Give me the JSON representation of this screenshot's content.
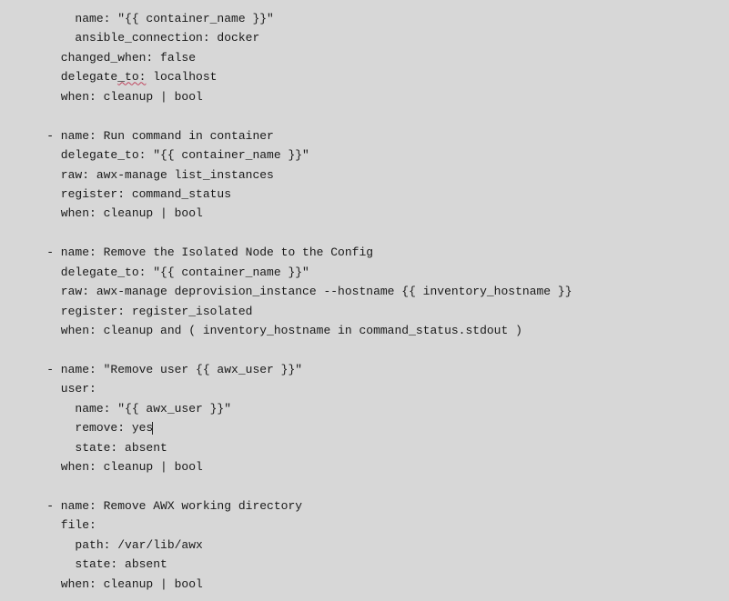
{
  "code": {
    "l1": "        name: \"{{ container_name }}\"",
    "l2": "        ansible_connection: docker",
    "l3": "      changed_when: false",
    "l4_pre": "      delegate",
    "l4_u": "_to:",
    "l4_post": " localhost",
    "l5": "      when: cleanup | bool",
    "blank1": "",
    "l6": "    - name: Run command in container",
    "l7": "      delegate_to: \"{{ container_name }}\"",
    "l8": "      raw: awx-manage list_instances",
    "l9": "      register: command_status",
    "l10": "      when: cleanup | bool",
    "blank2": "",
    "l11": "    - name: Remove the Isolated Node to the Config",
    "l12": "      delegate_to: \"{{ container_name }}\"",
    "l13": "      raw: awx-manage deprovision_instance --hostname {{ inventory_hostname }}",
    "l14": "      register: register_isolated",
    "l15": "      when: cleanup and ( inventory_hostname in command_status.stdout )",
    "blank3": "",
    "l16": "    - name: \"Remove user {{ awx_user }}\"",
    "l17": "      user:",
    "l18": "        name: \"{{ awx_user }}\"",
    "l19": "        remove: yes",
    "l20": "        state: absent",
    "l21": "      when: cleanup | bool",
    "blank4": "",
    "l22": "    - name: Remove AWX working directory",
    "l23": "      file:",
    "l24": "        path: /var/lib/awx",
    "l25": "        state: absent",
    "l26": "      when: cleanup | bool"
  }
}
